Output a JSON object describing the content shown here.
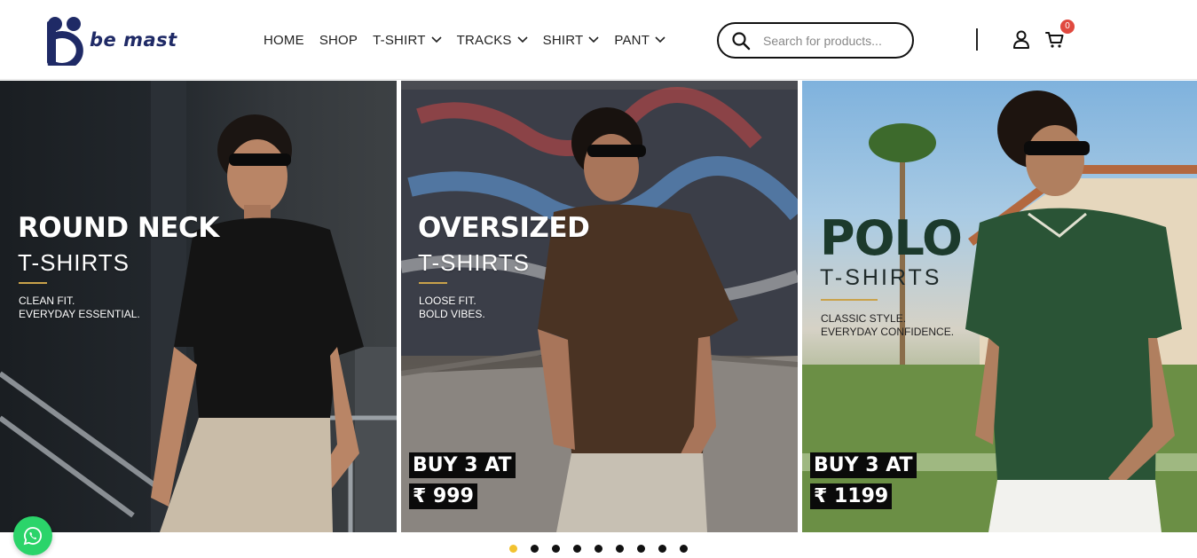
{
  "brand": {
    "name": "be mast",
    "color": "#1f2a66"
  },
  "nav": [
    {
      "label": "HOME",
      "dropdown": false
    },
    {
      "label": "SHOP",
      "dropdown": false
    },
    {
      "label": "T-SHIRT",
      "dropdown": true
    },
    {
      "label": "TRACKS",
      "dropdown": true
    },
    {
      "label": "SHIRT",
      "dropdown": true
    },
    {
      "label": "PANT",
      "dropdown": true
    }
  ],
  "search": {
    "placeholder": "Search for products...",
    "value": ""
  },
  "cart": {
    "count": "0",
    "badge_color": "#e0493f"
  },
  "slides": [
    {
      "title": "ROUND NECK",
      "subtitle": "T-SHIRTS",
      "desc_line1": "CLEAN FIT.",
      "desc_line2": "EVERYDAY ESSENTIAL.",
      "offer_line1": "",
      "offer_line2": ""
    },
    {
      "title": "OVERSIZED",
      "subtitle": "T-SHIRTS",
      "desc_line1": "LOOSE FIT.",
      "desc_line2": "BOLD VIBES.",
      "offer_line1": "BUY 3 AT",
      "offer_line2": "₹ 999"
    },
    {
      "title": "POLO",
      "subtitle": "T-SHIRTS",
      "desc_line1": "CLASSIC STYLE.",
      "desc_line2": "EVERYDAY CONFIDENCE.",
      "offer_line1": "BUY 3 AT",
      "offer_line2": "₹ 1199"
    }
  ],
  "carousel": {
    "total_dots": 9,
    "active_index": 0,
    "active_color": "#f2c230"
  },
  "icons": {
    "search": "search-icon",
    "user": "user-icon",
    "cart": "cart-icon",
    "chevron": "chevron-down-icon",
    "whatsapp": "whatsapp-icon"
  },
  "colors": {
    "whatsapp": "#2bd46a",
    "polo_title": "#1c3a2c",
    "accent_rule": "#c9a24a"
  }
}
